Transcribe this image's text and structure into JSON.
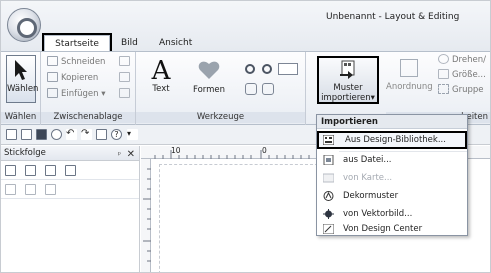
{
  "window": {
    "title": "Unbenannt - Layout & Editing"
  },
  "tabs": [
    {
      "label": "Startseite"
    },
    {
      "label": "Bild"
    },
    {
      "label": "Ansicht"
    }
  ],
  "ribbon": {
    "groups": {
      "waehlen": {
        "label": "Wählen",
        "button": "Wählen"
      },
      "clipboard": {
        "label": "Zwischenablage",
        "cut": "Schneiden",
        "copy": "Kopieren",
        "paste": "Einfügen"
      },
      "tools": {
        "label": "Werkzeuge",
        "text": "Text",
        "shapes": "Formen"
      },
      "import": {
        "label_line1": "Muster",
        "label_line2": "importieren"
      },
      "arrange": {
        "arrange": "Anordnung",
        "rotate": "Drehen/",
        "size": "Größe...",
        "group": "Gruppe",
        "label_partial": "beiten"
      }
    }
  },
  "panel": {
    "title": "Stickfolge",
    "pin": "ᵖ",
    "close": "✕"
  },
  "ruler": {
    "tick_10": "10",
    "tick_0": "0"
  },
  "dropdown": {
    "header": "Importieren",
    "items": [
      {
        "label": "Aus Design-Bibliothek...",
        "icon": "library-icon"
      },
      {
        "label": "aus Datei...",
        "icon": "file-icon"
      },
      {
        "label": "von Karte...",
        "icon": "card-icon"
      },
      {
        "label": "Dekormuster",
        "icon": "decor-pattern-icon"
      },
      {
        "label": "von Vektorbild...",
        "icon": "vector-image-icon"
      },
      {
        "label": "Von Design Center",
        "icon": "design-center-icon"
      }
    ]
  },
  "colors": {
    "ribbon_bg": "#e9edf3",
    "highlight_border": "#000000",
    "disabled_text": "#a4a9b1"
  }
}
